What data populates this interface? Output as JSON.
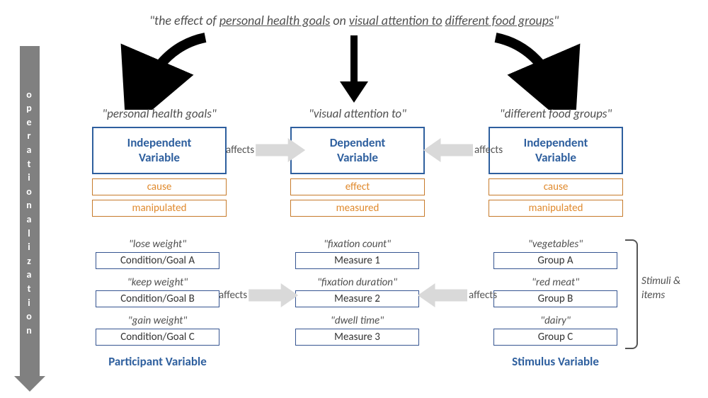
{
  "title_prefix": "\"the ",
  "title_effect": "effect",
  "title_of": " of ",
  "title_u1": "personal health goals",
  "title_on": " on ",
  "title_u2": "visual attention to",
  "title_sp": " ",
  "title_u3": "different food groups",
  "title_end": "\"",
  "sidebar_label": "operationalization",
  "col_left": {
    "heading": "\"personal health goals\"",
    "var_line1": "Independent",
    "var_line2": "Variable",
    "tag1": "cause",
    "tag2": "manipulated",
    "items": [
      {
        "label": "\"lose weight\"",
        "box": "Condition/Goal A"
      },
      {
        "label": "\"keep weight\"",
        "box": "Condition/Goal B"
      },
      {
        "label": "\"gain weight\"",
        "box": "Condition/Goal C"
      }
    ],
    "bottom": "Participant Variable"
  },
  "col_center": {
    "heading": "\"visual attention to\"",
    "var_line1": "Dependent",
    "var_line2": "Variable",
    "tag1": "effect",
    "tag2": "measured",
    "items": [
      {
        "label": "\"fixation count\"",
        "box": "Measure 1"
      },
      {
        "label": "\"fixation duration\"",
        "box": "Measure 2"
      },
      {
        "label": "\"dwell time\"",
        "box": "Measure 3"
      }
    ]
  },
  "col_right": {
    "heading": "\"different food groups\"",
    "var_line1": "Independent",
    "var_line2": "Variable",
    "tag1": "cause",
    "tag2": "manipulated",
    "items": [
      {
        "label": "\"vegetables\"",
        "box": "Group A"
      },
      {
        "label": "\"red meat\"",
        "box": "Group B"
      },
      {
        "label": "\"dairy\"",
        "box": "Group C"
      }
    ],
    "bottom": "Stimulus Variable"
  },
  "affects_label": "affects",
  "brace_text": "Stimuli & items"
}
